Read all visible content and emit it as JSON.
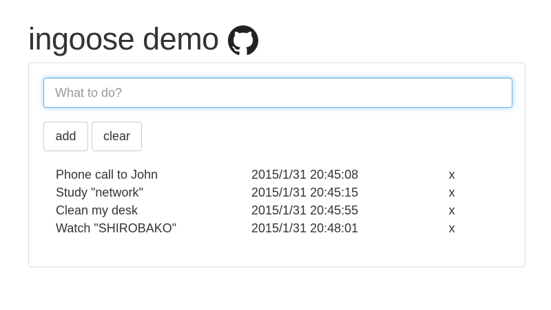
{
  "header": {
    "title": "ingoose demo",
    "github_icon": "github-icon"
  },
  "form": {
    "input_value": "",
    "input_placeholder": "What to do?",
    "add_label": "add",
    "clear_label": "clear"
  },
  "todos": [
    {
      "text": "Phone call to John",
      "time": "2015/1/31 20:45:08",
      "remove_label": "x"
    },
    {
      "text": "Study \"network\"",
      "time": "2015/1/31 20:45:15",
      "remove_label": "x"
    },
    {
      "text": "Clean my desk",
      "time": "2015/1/31 20:45:55",
      "remove_label": "x"
    },
    {
      "text": "Watch \"SHIROBAKO\"",
      "time": "2015/1/31 20:48:01",
      "remove_label": "x"
    }
  ],
  "colors": {
    "focus_border": "#66afe9",
    "text": "#333333",
    "panel_border": "#dddddd"
  }
}
